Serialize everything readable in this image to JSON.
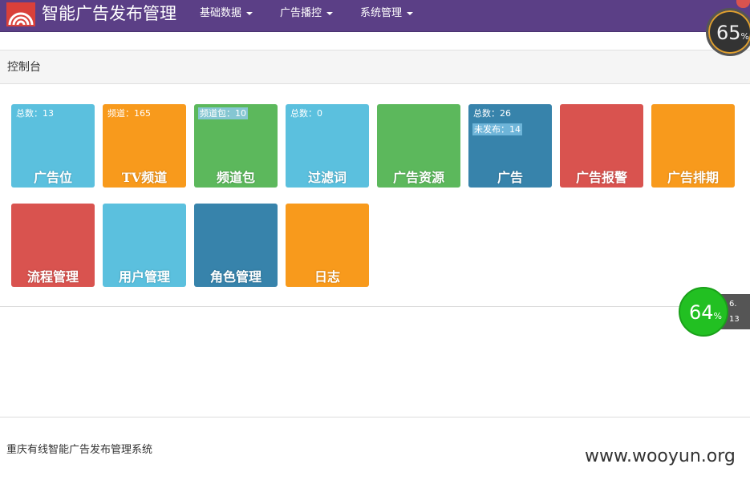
{
  "header": {
    "brand": "智能广告发布管理",
    "menus": [
      {
        "label": "基础数据"
      },
      {
        "label": "广告播控"
      },
      {
        "label": "系统管理"
      }
    ],
    "nav_color": "#5b3f86"
  },
  "breadcrumb": {
    "title": "控制台"
  },
  "tiles": [
    {
      "label": "广告位",
      "info": "总数：13",
      "color": "#5bc0de"
    },
    {
      "label": "TV频道",
      "info": "频道：165",
      "color": "#f89a1c"
    },
    {
      "label": "频道包",
      "info": "频道包：10",
      "color": "#5cb85c"
    },
    {
      "label": "过滤词",
      "info": "总数：0",
      "color": "#5bc0de"
    },
    {
      "label": "广告资源",
      "color": "#5cb85c"
    },
    {
      "label": "广告",
      "info": "总数：26",
      "info2": "未发布：14",
      "color": "#3783ab"
    },
    {
      "label": "广告报警",
      "color": "#d9534f"
    },
    {
      "label": "广告排期",
      "color": "#f89a1c"
    },
    {
      "label": "流程管理",
      "color": "#d9534f"
    },
    {
      "label": "用户管理",
      "color": "#5bc0de"
    },
    {
      "label": "角色管理",
      "color": "#3783ab"
    },
    {
      "label": "日志",
      "color": "#f89a1c"
    }
  ],
  "footer": {
    "text": "重庆有线智能广告发布管理系统",
    "watermark": "www.wooyun.org"
  },
  "overlays": {
    "gauge_top": {
      "value": "65",
      "unit": "%"
    },
    "gauge_green": {
      "value": "64",
      "unit": "%"
    },
    "upload": "6.",
    "download": "13"
  }
}
